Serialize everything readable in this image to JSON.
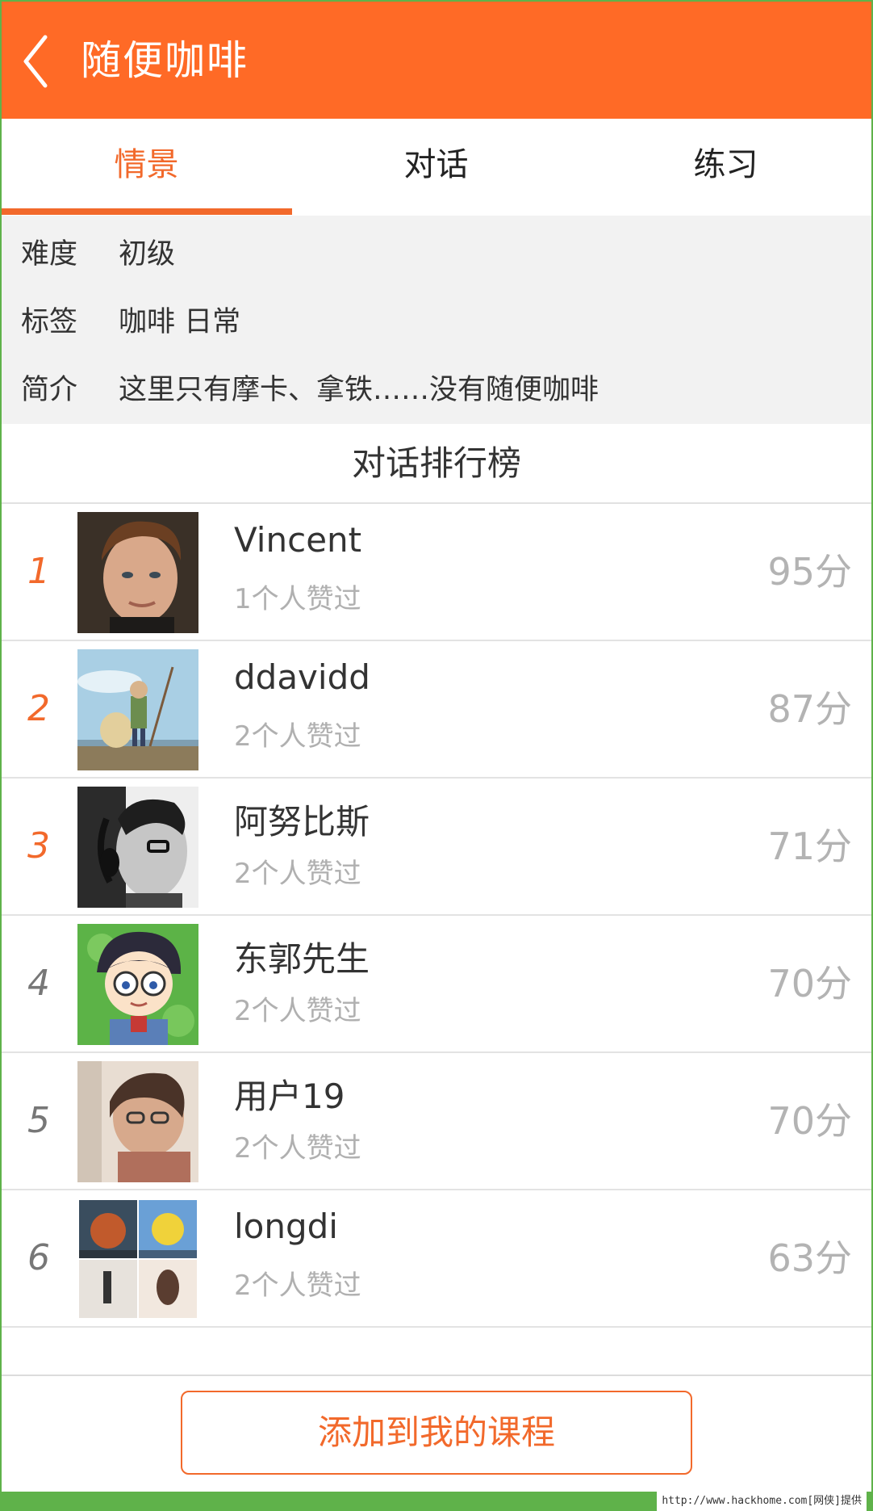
{
  "header": {
    "title": "随便咖啡",
    "back_icon": "chevron-left-icon"
  },
  "tabs": [
    {
      "label": "情景",
      "active": true
    },
    {
      "label": "对话",
      "active": false
    },
    {
      "label": "练习",
      "active": false
    }
  ],
  "info": [
    {
      "key": "难度",
      "value": "初级"
    },
    {
      "key": "标签",
      "value": "咖啡 日常"
    },
    {
      "key": "简介",
      "value": "这里只有摩卡、拿铁……没有随便咖啡"
    }
  ],
  "leaderboard": {
    "title": "对话排行榜",
    "rows": [
      {
        "rank": "1",
        "name": "Vincent",
        "likes": "1个人赞过",
        "score": "95分",
        "avatar": "portrait-photo"
      },
      {
        "rank": "2",
        "name": "ddavidd",
        "likes": "2个人赞过",
        "score": "87分",
        "avatar": "anime-landscape"
      },
      {
        "rank": "3",
        "name": "阿努比斯",
        "likes": "2个人赞过",
        "score": "71分",
        "avatar": "headphones-bw-photo"
      },
      {
        "rank": "4",
        "name": "东郭先生",
        "likes": "2个人赞过",
        "score": "70分",
        "avatar": "cartoon-boy-glasses"
      },
      {
        "rank": "5",
        "name": "用户19",
        "likes": "2个人赞过",
        "score": "70分",
        "avatar": "selfie-photo"
      },
      {
        "rank": "6",
        "name": "longdi",
        "likes": "2个人赞过",
        "score": "63分",
        "avatar": "photo-collage"
      }
    ]
  },
  "actions": {
    "add_course": "添加到我的课程"
  },
  "watermark": "http://www.hackhome.com[网侠]提供",
  "colors": {
    "accent": "#ff6a26",
    "text_accent": "#f2692b",
    "frame_green": "#5fb24a"
  }
}
